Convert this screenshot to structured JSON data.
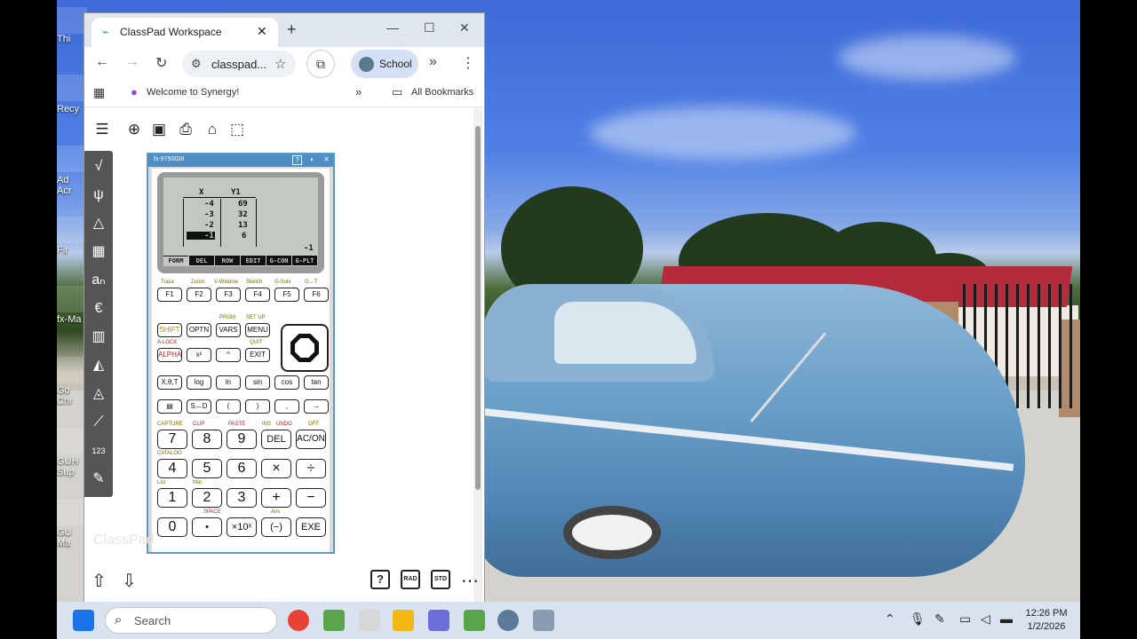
{
  "browser": {
    "tab_title": "ClassPad Workspace",
    "url": "classpad...",
    "profile_label": "School",
    "bookmark_1": "Welcome to Synergy!",
    "bookmark_all": "All Bookmarks"
  },
  "classpad": {
    "watermark": "ClassPad",
    "bottom_rad": "RAD",
    "bottom_std": "STD"
  },
  "calculator": {
    "model": "fx-9750GIII",
    "table_header_x": "X",
    "table_header_y": "Y1",
    "rows": [
      {
        "x": "-4",
        "y": "69"
      },
      {
        "x": "-3",
        "y": "32"
      },
      {
        "x": "-2",
        "y": "13"
      },
      {
        "x": "-1",
        "y": "6"
      }
    ],
    "status_value": "-1",
    "fkeys": [
      "FORM",
      "DEL",
      "ROW",
      "EDIT",
      "G-CON",
      "G-PLT"
    ],
    "fkey_labels_above": [
      "Trace",
      "Zoom",
      "V-Window",
      "Sketch",
      "G-Solv",
      "G↔T"
    ],
    "fkey_buttons": [
      "F1",
      "F2",
      "F3",
      "F4",
      "F5",
      "F6"
    ],
    "row2_labels_above": [
      "PRGM",
      "SET UP"
    ],
    "row2": [
      "SHIFT",
      "OPTN",
      "VARS",
      "MENU"
    ],
    "row3_labels_above": [
      "A-LOCK",
      "QUIT"
    ],
    "row3": [
      "ALPHA",
      "x²",
      "^",
      "EXIT"
    ],
    "row4": [
      "X,θ,T",
      "log",
      "ln",
      "sin",
      "cos",
      "tan"
    ],
    "row5": [
      "▤",
      "S↔D",
      "(",
      ")",
      ",",
      "→"
    ],
    "row6_labels_above": [
      "CAPTURE",
      "CLIP",
      "PASTE",
      "INS",
      "UNDO",
      "OFF"
    ],
    "row6": [
      "7",
      "8",
      "9",
      "DEL",
      "AC/ON"
    ],
    "row7_labels_above": [
      "CATALOG"
    ],
    "row7": [
      "4",
      "5",
      "6",
      "×",
      "÷"
    ],
    "row8_labels_above": [
      "List",
      "Mat"
    ],
    "row8": [
      "1",
      "2",
      "3",
      "+",
      "−"
    ],
    "row9_labels_above": [
      "SPACE",
      "Ans"
    ],
    "row9": [
      "0",
      "•",
      "×10ˣ",
      "(−)",
      "EXE"
    ]
  },
  "taskbar": {
    "search_placeholder": "Search",
    "time": "12:26 PM",
    "date": "1/2/2026"
  },
  "desktop_labels": [
    "Thi",
    "Recy",
    "Ad Acr",
    "Fir",
    "fx-Ma",
    "Go Chr",
    "GUH Sup",
    "GU Ma"
  ],
  "colors": {
    "calc_frame": "#5b97c8",
    "lcd": "#c4c8c2",
    "taskbar": "#d9e3ef"
  }
}
